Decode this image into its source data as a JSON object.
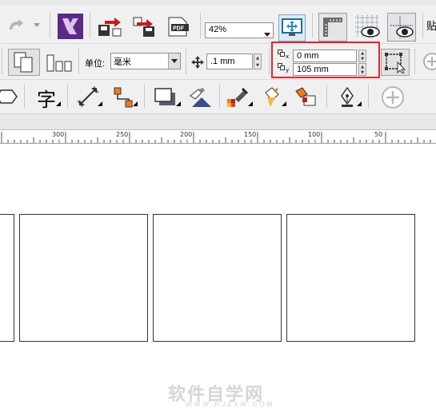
{
  "standard_toolbar": {
    "zoom_value": "42%"
  },
  "property_bar": {
    "units_label": "单位:",
    "units_value": "毫米",
    "nudge_value": ".1 mm",
    "duplicate_x_label": "x",
    "duplicate_x_value": "0 mm",
    "duplicate_y_label": "y",
    "duplicate_y_value": "105 mm"
  },
  "toolbox": {
    "text_tool_glyph": "字"
  },
  "ruler": {
    "tick_labels": [
      "300",
      "250",
      "200",
      "150",
      "100",
      "50"
    ]
  },
  "canvas": {
    "page_count_visible": 4
  },
  "watermark": {
    "main_text": "软件自学网",
    "sub_text": "WWW.RJZXW.COM"
  },
  "colors": {
    "highlight_box": "#e5272a",
    "corel_purple": "#5a2a86",
    "accent_red": "#c0201e"
  }
}
